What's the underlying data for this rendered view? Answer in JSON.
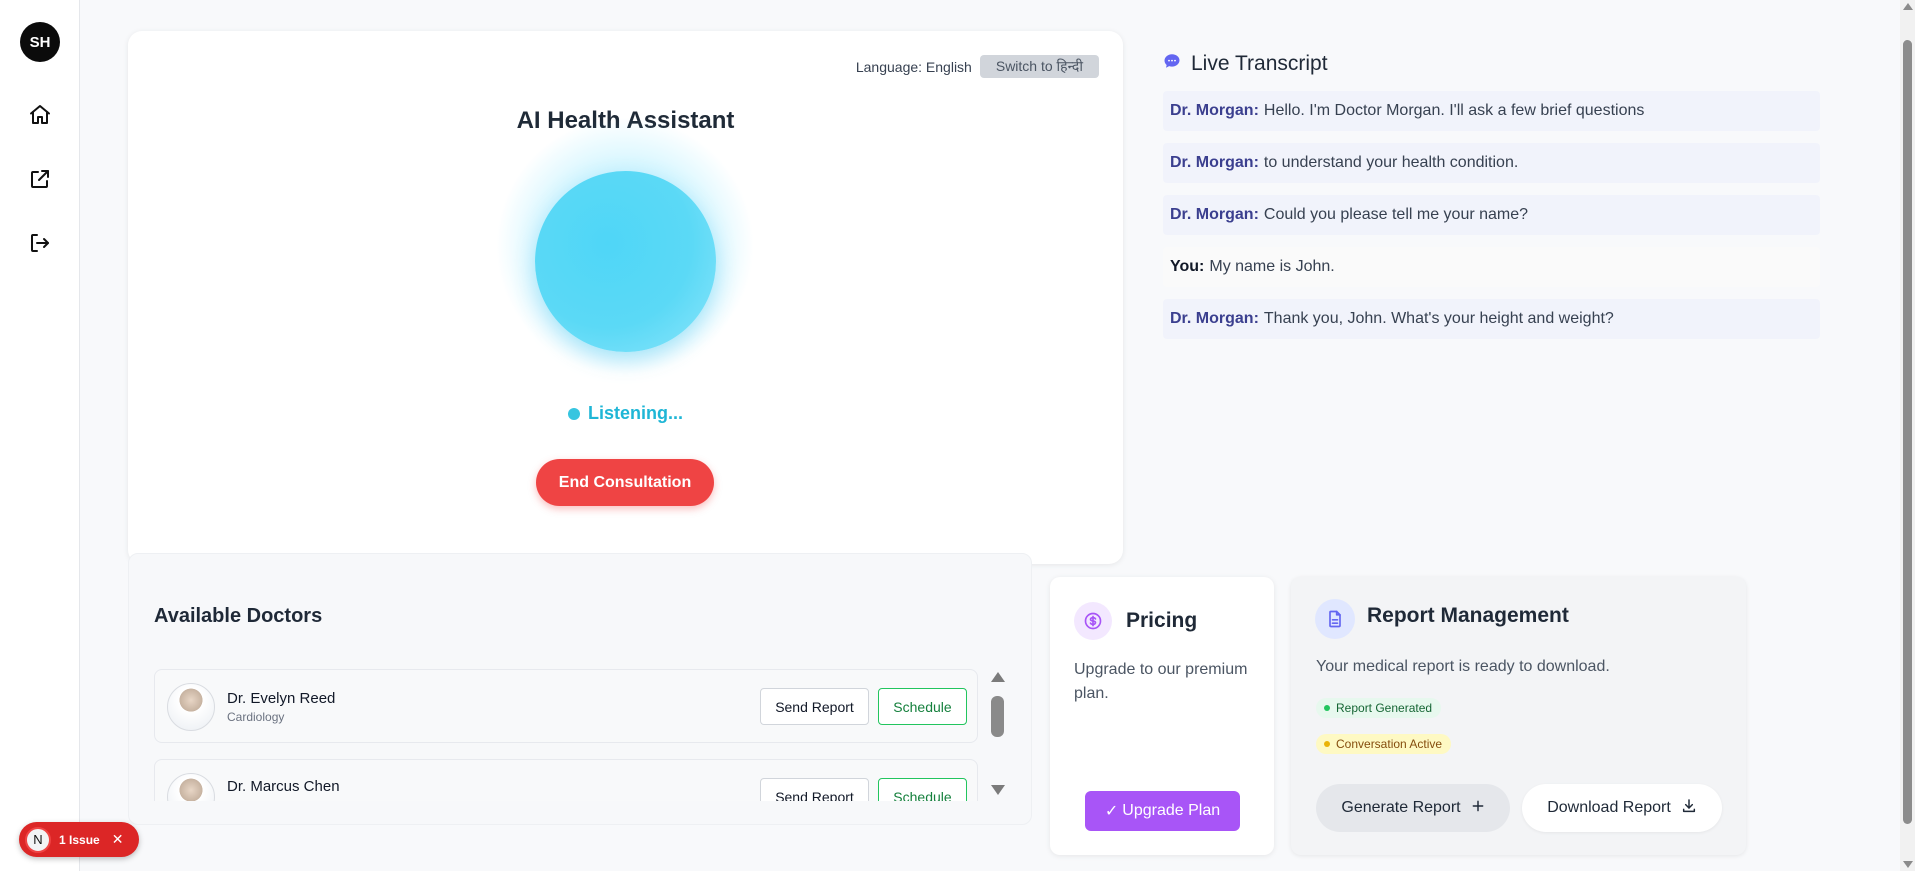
{
  "user": {
    "initials": "SH"
  },
  "sidebar": {
    "items": [
      {
        "icon": "home-icon"
      },
      {
        "icon": "external-link-icon"
      },
      {
        "icon": "logout-icon"
      }
    ]
  },
  "assistant": {
    "language_label": "Language: English",
    "switch_label": "Switch to हिन्दी",
    "title": "AI Health Assistant",
    "status": "Listening...",
    "end_button": "End Consultation",
    "colors": {
      "orb": "#5bd9f6",
      "end_button": "#ef4444",
      "status": "#1fb6d6"
    }
  },
  "transcript": {
    "title": "Live Transcript",
    "messages": [
      {
        "speaker": "Dr. Morgan:",
        "text": "Hello. I'm Doctor Morgan. I'll ask a few brief questions"
      },
      {
        "speaker": "Dr. Morgan:",
        "text": "to understand your health condition."
      },
      {
        "speaker": "Dr. Morgan:",
        "text": "Could you please tell me your name?"
      },
      {
        "speaker": "You:",
        "text": "My name is John."
      },
      {
        "speaker": "Dr. Morgan:",
        "text": "Thank you, John. What's your height and weight?"
      }
    ]
  },
  "doctors": {
    "title": "Available Doctors",
    "list": [
      {
        "name": "Dr. Evelyn Reed",
        "specialty": "Cardiology",
        "send_label": "Send Report",
        "schedule_label": "Schedule"
      },
      {
        "name": "Dr. Marcus Chen",
        "specialty": "",
        "send_label": "Send Report",
        "schedule_label": "Schedule"
      }
    ]
  },
  "pricing": {
    "title": "Pricing",
    "text": "Upgrade to our premium plan.",
    "button": "Upgrade Plan",
    "accent": "#a855f7"
  },
  "report": {
    "title": "Report Management",
    "text": "Your medical report is ready to download.",
    "badges": [
      {
        "label": "Report Generated",
        "color": "#22c55e"
      },
      {
        "label": "Conversation Active",
        "color": "#eab308"
      }
    ],
    "generate_button": "Generate Report",
    "download_button": "Download Report"
  },
  "issue_toast": {
    "badge": "N",
    "label": "1 Issue"
  }
}
